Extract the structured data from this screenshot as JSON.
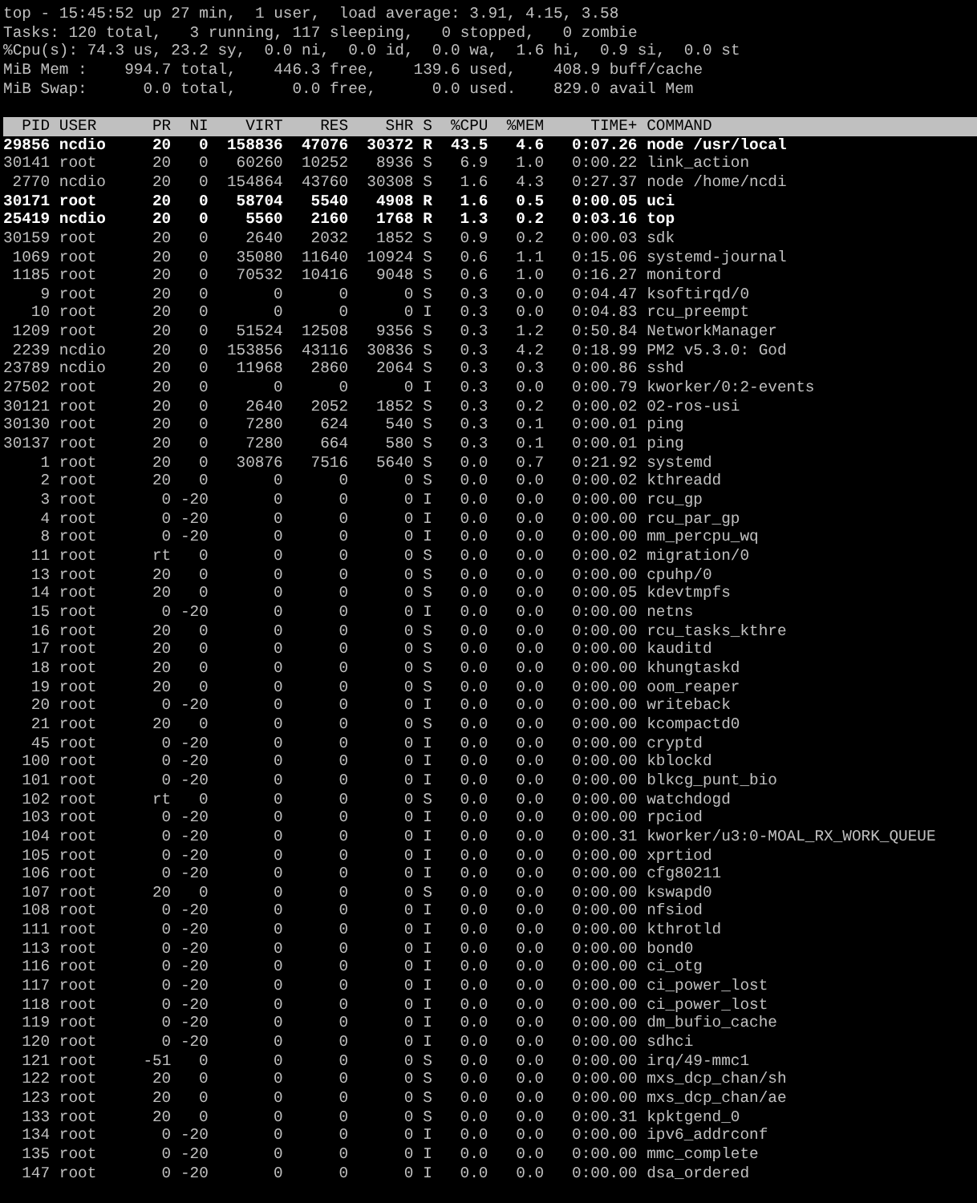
{
  "summary_lines": [
    "top - 15:45:52 up 27 min,  1 user,  load average: 3.91, 4.15, 3.58",
    "Tasks: 120 total,   3 running, 117 sleeping,   0 stopped,   0 zombie",
    "%Cpu(s): 74.3 us, 23.2 sy,  0.0 ni,  0.0 id,  0.0 wa,  1.6 hi,  0.9 si,  0.0 st",
    "MiB Mem :    994.7 total,    446.3 free,    139.6 used,    408.9 buff/cache",
    "MiB Swap:      0.0 total,      0.0 free,      0.0 used.    829.0 avail Mem"
  ],
  "table": {
    "columns": [
      "PID",
      "USER",
      "PR",
      "NI",
      "VIRT",
      "RES",
      "SHR",
      "S",
      "%CPU",
      "%MEM",
      "TIME+",
      "COMMAND"
    ],
    "rows": [
      {
        "cells": [
          "29856",
          "ncdio",
          "20",
          "0",
          "158836",
          "47076",
          "30372",
          "R",
          "43.5",
          "4.6",
          "0:07.26",
          "node /usr/local"
        ],
        "running": true
      },
      {
        "cells": [
          "30141",
          "root",
          "20",
          "0",
          "60260",
          "10252",
          "8936",
          "S",
          "6.9",
          "1.0",
          "0:00.22",
          "link_action"
        ],
        "running": false
      },
      {
        "cells": [
          "2770",
          "ncdio",
          "20",
          "0",
          "154864",
          "43760",
          "30308",
          "S",
          "1.6",
          "4.3",
          "0:27.37",
          "node /home/ncdi"
        ],
        "running": false
      },
      {
        "cells": [
          "30171",
          "root",
          "20",
          "0",
          "58704",
          "5540",
          "4908",
          "R",
          "1.6",
          "0.5",
          "0:00.05",
          "uci"
        ],
        "running": true
      },
      {
        "cells": [
          "25419",
          "ncdio",
          "20",
          "0",
          "5560",
          "2160",
          "1768",
          "R",
          "1.3",
          "0.2",
          "0:03.16",
          "top"
        ],
        "running": true
      },
      {
        "cells": [
          "30159",
          "root",
          "20",
          "0",
          "2640",
          "2032",
          "1852",
          "S",
          "0.9",
          "0.2",
          "0:00.03",
          "sdk"
        ],
        "running": false
      },
      {
        "cells": [
          "1069",
          "root",
          "20",
          "0",
          "35080",
          "11640",
          "10924",
          "S",
          "0.6",
          "1.1",
          "0:15.06",
          "systemd-journal"
        ],
        "running": false
      },
      {
        "cells": [
          "1185",
          "root",
          "20",
          "0",
          "70532",
          "10416",
          "9048",
          "S",
          "0.6",
          "1.0",
          "0:16.27",
          "monitord"
        ],
        "running": false
      },
      {
        "cells": [
          "9",
          "root",
          "20",
          "0",
          "0",
          "0",
          "0",
          "S",
          "0.3",
          "0.0",
          "0:04.47",
          "ksoftirqd/0"
        ],
        "running": false
      },
      {
        "cells": [
          "10",
          "root",
          "20",
          "0",
          "0",
          "0",
          "0",
          "I",
          "0.3",
          "0.0",
          "0:04.83",
          "rcu_preempt"
        ],
        "running": false
      },
      {
        "cells": [
          "1209",
          "root",
          "20",
          "0",
          "51524",
          "12508",
          "9356",
          "S",
          "0.3",
          "1.2",
          "0:50.84",
          "NetworkManager"
        ],
        "running": false
      },
      {
        "cells": [
          "2239",
          "ncdio",
          "20",
          "0",
          "153856",
          "43116",
          "30836",
          "S",
          "0.3",
          "4.2",
          "0:18.99",
          "PM2 v5.3.0: God"
        ],
        "running": false
      },
      {
        "cells": [
          "23789",
          "ncdio",
          "20",
          "0",
          "11968",
          "2860",
          "2064",
          "S",
          "0.3",
          "0.3",
          "0:00.86",
          "sshd"
        ],
        "running": false
      },
      {
        "cells": [
          "27502",
          "root",
          "20",
          "0",
          "0",
          "0",
          "0",
          "I",
          "0.3",
          "0.0",
          "0:00.79",
          "kworker/0:2-events"
        ],
        "running": false
      },
      {
        "cells": [
          "30121",
          "root",
          "20",
          "0",
          "2640",
          "2052",
          "1852",
          "S",
          "0.3",
          "0.2",
          "0:00.02",
          "02-ros-usi"
        ],
        "running": false
      },
      {
        "cells": [
          "30130",
          "root",
          "20",
          "0",
          "7280",
          "624",
          "540",
          "S",
          "0.3",
          "0.1",
          "0:00.01",
          "ping"
        ],
        "running": false
      },
      {
        "cells": [
          "30137",
          "root",
          "20",
          "0",
          "7280",
          "664",
          "580",
          "S",
          "0.3",
          "0.1",
          "0:00.01",
          "ping"
        ],
        "running": false
      },
      {
        "cells": [
          "1",
          "root",
          "20",
          "0",
          "30876",
          "7516",
          "5640",
          "S",
          "0.0",
          "0.7",
          "0:21.92",
          "systemd"
        ],
        "running": false
      },
      {
        "cells": [
          "2",
          "root",
          "20",
          "0",
          "0",
          "0",
          "0",
          "S",
          "0.0",
          "0.0",
          "0:00.02",
          "kthreadd"
        ],
        "running": false
      },
      {
        "cells": [
          "3",
          "root",
          "0",
          "-20",
          "0",
          "0",
          "0",
          "I",
          "0.0",
          "0.0",
          "0:00.00",
          "rcu_gp"
        ],
        "running": false
      },
      {
        "cells": [
          "4",
          "root",
          "0",
          "-20",
          "0",
          "0",
          "0",
          "I",
          "0.0",
          "0.0",
          "0:00.00",
          "rcu_par_gp"
        ],
        "running": false
      },
      {
        "cells": [
          "8",
          "root",
          "0",
          "-20",
          "0",
          "0",
          "0",
          "I",
          "0.0",
          "0.0",
          "0:00.00",
          "mm_percpu_wq"
        ],
        "running": false
      },
      {
        "cells": [
          "11",
          "root",
          "rt",
          "0",
          "0",
          "0",
          "0",
          "S",
          "0.0",
          "0.0",
          "0:00.02",
          "migration/0"
        ],
        "running": false
      },
      {
        "cells": [
          "13",
          "root",
          "20",
          "0",
          "0",
          "0",
          "0",
          "S",
          "0.0",
          "0.0",
          "0:00.00",
          "cpuhp/0"
        ],
        "running": false
      },
      {
        "cells": [
          "14",
          "root",
          "20",
          "0",
          "0",
          "0",
          "0",
          "S",
          "0.0",
          "0.0",
          "0:00.05",
          "kdevtmpfs"
        ],
        "running": false
      },
      {
        "cells": [
          "15",
          "root",
          "0",
          "-20",
          "0",
          "0",
          "0",
          "I",
          "0.0",
          "0.0",
          "0:00.00",
          "netns"
        ],
        "running": false
      },
      {
        "cells": [
          "16",
          "root",
          "20",
          "0",
          "0",
          "0",
          "0",
          "S",
          "0.0",
          "0.0",
          "0:00.00",
          "rcu_tasks_kthre"
        ],
        "running": false
      },
      {
        "cells": [
          "17",
          "root",
          "20",
          "0",
          "0",
          "0",
          "0",
          "S",
          "0.0",
          "0.0",
          "0:00.00",
          "kauditd"
        ],
        "running": false
      },
      {
        "cells": [
          "18",
          "root",
          "20",
          "0",
          "0",
          "0",
          "0",
          "S",
          "0.0",
          "0.0",
          "0:00.00",
          "khungtaskd"
        ],
        "running": false
      },
      {
        "cells": [
          "19",
          "root",
          "20",
          "0",
          "0",
          "0",
          "0",
          "S",
          "0.0",
          "0.0",
          "0:00.00",
          "oom_reaper"
        ],
        "running": false
      },
      {
        "cells": [
          "20",
          "root",
          "0",
          "-20",
          "0",
          "0",
          "0",
          "I",
          "0.0",
          "0.0",
          "0:00.00",
          "writeback"
        ],
        "running": false
      },
      {
        "cells": [
          "21",
          "root",
          "20",
          "0",
          "0",
          "0",
          "0",
          "S",
          "0.0",
          "0.0",
          "0:00.00",
          "kcompactd0"
        ],
        "running": false
      },
      {
        "cells": [
          "45",
          "root",
          "0",
          "-20",
          "0",
          "0",
          "0",
          "I",
          "0.0",
          "0.0",
          "0:00.00",
          "cryptd"
        ],
        "running": false
      },
      {
        "cells": [
          "100",
          "root",
          "0",
          "-20",
          "0",
          "0",
          "0",
          "I",
          "0.0",
          "0.0",
          "0:00.00",
          "kblockd"
        ],
        "running": false
      },
      {
        "cells": [
          "101",
          "root",
          "0",
          "-20",
          "0",
          "0",
          "0",
          "I",
          "0.0",
          "0.0",
          "0:00.00",
          "blkcg_punt_bio"
        ],
        "running": false
      },
      {
        "cells": [
          "102",
          "root",
          "rt",
          "0",
          "0",
          "0",
          "0",
          "S",
          "0.0",
          "0.0",
          "0:00.00",
          "watchdogd"
        ],
        "running": false
      },
      {
        "cells": [
          "103",
          "root",
          "0",
          "-20",
          "0",
          "0",
          "0",
          "I",
          "0.0",
          "0.0",
          "0:00.00",
          "rpciod"
        ],
        "running": false
      },
      {
        "cells": [
          "104",
          "root",
          "0",
          "-20",
          "0",
          "0",
          "0",
          "I",
          "0.0",
          "0.0",
          "0:00.31",
          "kworker/u3:0-MOAL_RX_WORK_QUEUE"
        ],
        "running": false
      },
      {
        "cells": [
          "105",
          "root",
          "0",
          "-20",
          "0",
          "0",
          "0",
          "I",
          "0.0",
          "0.0",
          "0:00.00",
          "xprtiod"
        ],
        "running": false
      },
      {
        "cells": [
          "106",
          "root",
          "0",
          "-20",
          "0",
          "0",
          "0",
          "I",
          "0.0",
          "0.0",
          "0:00.00",
          "cfg80211"
        ],
        "running": false
      },
      {
        "cells": [
          "107",
          "root",
          "20",
          "0",
          "0",
          "0",
          "0",
          "S",
          "0.0",
          "0.0",
          "0:00.00",
          "kswapd0"
        ],
        "running": false
      },
      {
        "cells": [
          "108",
          "root",
          "0",
          "-20",
          "0",
          "0",
          "0",
          "I",
          "0.0",
          "0.0",
          "0:00.00",
          "nfsiod"
        ],
        "running": false
      },
      {
        "cells": [
          "111",
          "root",
          "0",
          "-20",
          "0",
          "0",
          "0",
          "I",
          "0.0",
          "0.0",
          "0:00.00",
          "kthrotld"
        ],
        "running": false
      },
      {
        "cells": [
          "113",
          "root",
          "0",
          "-20",
          "0",
          "0",
          "0",
          "I",
          "0.0",
          "0.0",
          "0:00.00",
          "bond0"
        ],
        "running": false
      },
      {
        "cells": [
          "116",
          "root",
          "0",
          "-20",
          "0",
          "0",
          "0",
          "I",
          "0.0",
          "0.0",
          "0:00.00",
          "ci_otg"
        ],
        "running": false
      },
      {
        "cells": [
          "117",
          "root",
          "0",
          "-20",
          "0",
          "0",
          "0",
          "I",
          "0.0",
          "0.0",
          "0:00.00",
          "ci_power_lost"
        ],
        "running": false
      },
      {
        "cells": [
          "118",
          "root",
          "0",
          "-20",
          "0",
          "0",
          "0",
          "I",
          "0.0",
          "0.0",
          "0:00.00",
          "ci_power_lost"
        ],
        "running": false
      },
      {
        "cells": [
          "119",
          "root",
          "0",
          "-20",
          "0",
          "0",
          "0",
          "I",
          "0.0",
          "0.0",
          "0:00.00",
          "dm_bufio_cache"
        ],
        "running": false
      },
      {
        "cells": [
          "120",
          "root",
          "0",
          "-20",
          "0",
          "0",
          "0",
          "I",
          "0.0",
          "0.0",
          "0:00.00",
          "sdhci"
        ],
        "running": false
      },
      {
        "cells": [
          "121",
          "root",
          "-51",
          "0",
          "0",
          "0",
          "0",
          "S",
          "0.0",
          "0.0",
          "0:00.00",
          "irq/49-mmc1"
        ],
        "running": false
      },
      {
        "cells": [
          "122",
          "root",
          "20",
          "0",
          "0",
          "0",
          "0",
          "S",
          "0.0",
          "0.0",
          "0:00.00",
          "mxs_dcp_chan/sh"
        ],
        "running": false
      },
      {
        "cells": [
          "123",
          "root",
          "20",
          "0",
          "0",
          "0",
          "0",
          "S",
          "0.0",
          "0.0",
          "0:00.00",
          "mxs_dcp_chan/ae"
        ],
        "running": false
      },
      {
        "cells": [
          "133",
          "root",
          "20",
          "0",
          "0",
          "0",
          "0",
          "S",
          "0.0",
          "0.0",
          "0:00.31",
          "kpktgend_0"
        ],
        "running": false
      },
      {
        "cells": [
          "134",
          "root",
          "0",
          "-20",
          "0",
          "0",
          "0",
          "I",
          "0.0",
          "0.0",
          "0:00.00",
          "ipv6_addrconf"
        ],
        "running": false
      },
      {
        "cells": [
          "135",
          "root",
          "0",
          "-20",
          "0",
          "0",
          "0",
          "I",
          "0.0",
          "0.0",
          "0:00.00",
          "mmc_complete"
        ],
        "running": false
      },
      {
        "cells": [
          "147",
          "root",
          "0",
          "-20",
          "0",
          "0",
          "0",
          "I",
          "0.0",
          "0.0",
          "0:00.00",
          "dsa_ordered"
        ],
        "running": false
      }
    ]
  }
}
